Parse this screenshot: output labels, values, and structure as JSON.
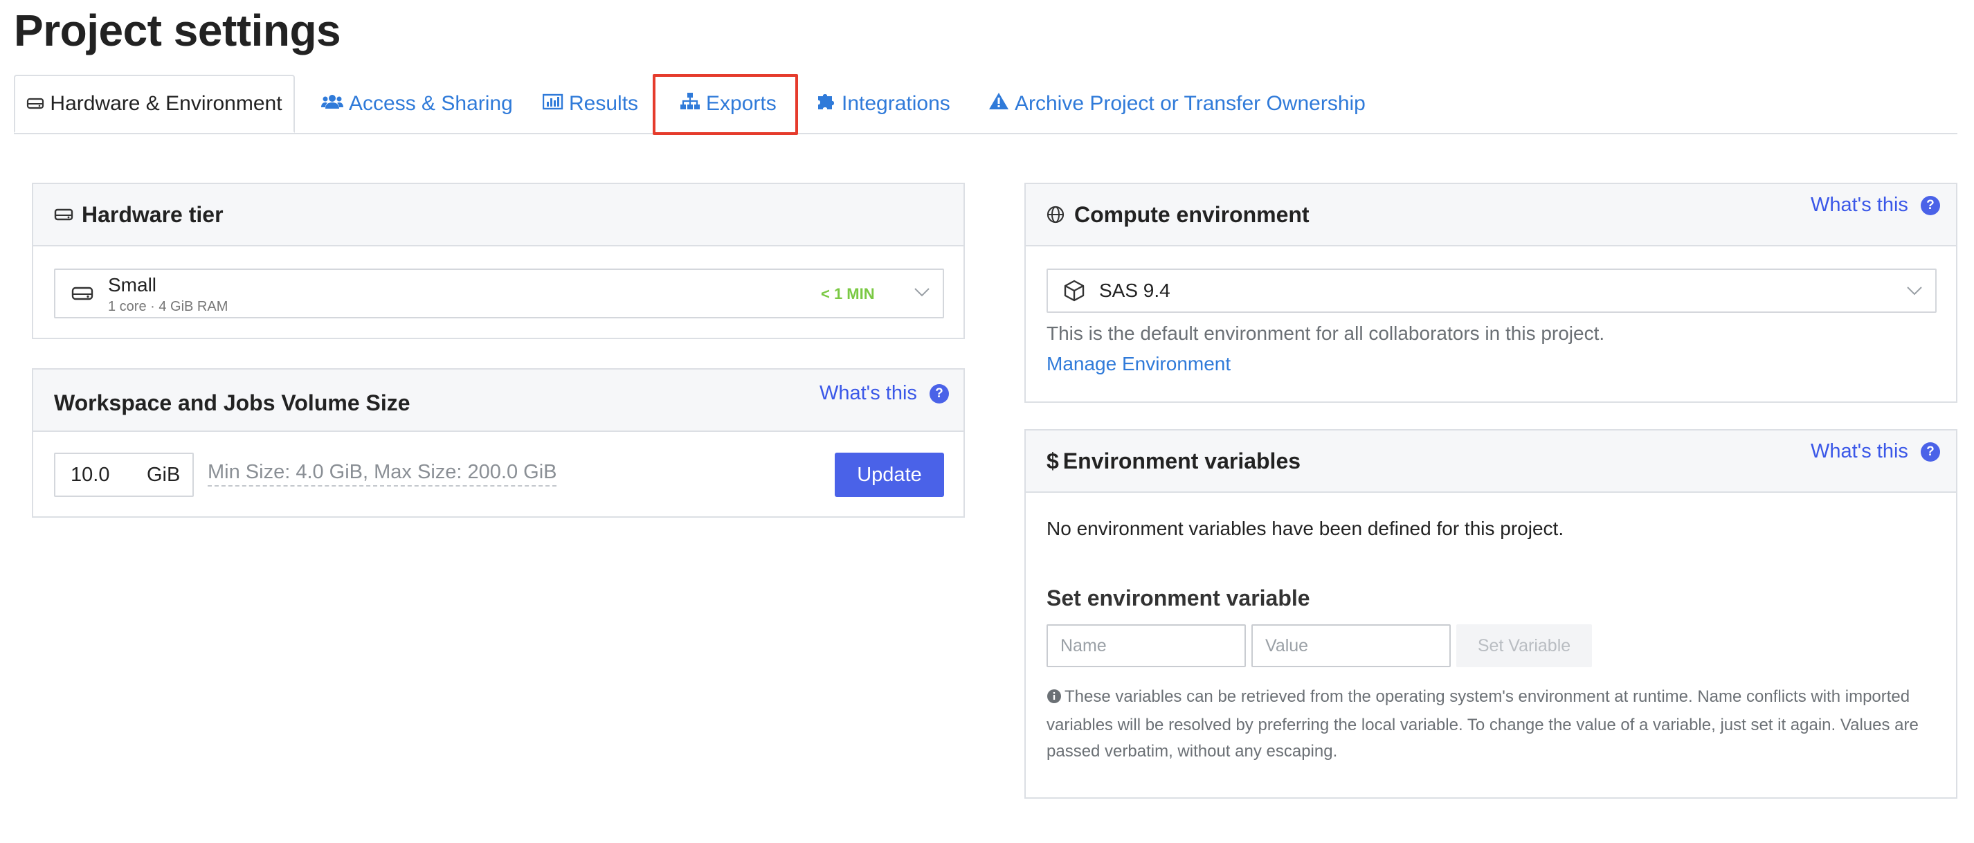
{
  "page": {
    "title": "Project settings"
  },
  "tabs": [
    {
      "label": "Hardware & Environment",
      "icon": "hard-drive-icon",
      "active": true
    },
    {
      "label": "Access & Sharing",
      "icon": "users-icon"
    },
    {
      "label": "Results",
      "icon": "bar-chart-icon"
    },
    {
      "label": "Exports",
      "icon": "sitemap-icon"
    },
    {
      "label": "Integrations",
      "icon": "puzzle-icon"
    },
    {
      "label": "Archive Project or Transfer Ownership",
      "icon": "warning-icon"
    }
  ],
  "hardware": {
    "title": "Hardware tier",
    "tier_name": "Small",
    "tier_spec": "1 core · 4 GiB RAM",
    "tier_time": "< 1 MIN"
  },
  "volume": {
    "title": "Workspace and Jobs Volume Size",
    "whats_this": "What's this",
    "size_value": "10.0",
    "unit": "GiB",
    "limits": "Min Size: 4.0 GiB, Max Size: 200.0 GiB",
    "update_label": "Update"
  },
  "compute": {
    "title": "Compute environment",
    "whats_this": "What's this",
    "selected": "SAS 9.4",
    "description": "This is the default environment for all collaborators in this project.",
    "manage_link": "Manage Environment"
  },
  "env_vars": {
    "title": "Environment variables",
    "whats_this": "What's this",
    "empty_message": "No environment variables have been defined for this project.",
    "set_heading": "Set environment variable",
    "name_placeholder": "Name",
    "value_placeholder": "Value",
    "set_button": "Set Variable",
    "help_text": "These variables can be retrieved from the operating system's environment at runtime. Name conflicts with imported variables will be resolved by preferring the local variable. To change the value of a variable, just set it again. Values are passed verbatim, without any escaping."
  },
  "colors": {
    "accent": "#4a62e8",
    "link": "#2f7ad9",
    "highlight": "#e53b2c",
    "time_badge": "#7ac943"
  }
}
